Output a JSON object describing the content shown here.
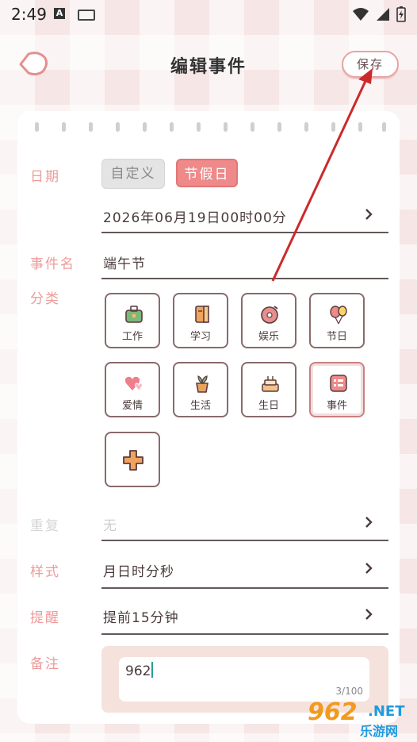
{
  "status": {
    "time": "2:49",
    "a_icon": "A"
  },
  "header": {
    "title": "编辑事件",
    "save_label": "保存"
  },
  "form": {
    "date_label": "日期",
    "date_tabs": [
      "自定义",
      "节假日"
    ],
    "date_value": "2026年06月19日00时00分",
    "name_label": "事件名",
    "name_value": "端午节",
    "category_label": "分类",
    "categories": [
      "工作",
      "学习",
      "娱乐",
      "节日",
      "爱情",
      "生活",
      "生日",
      "事件"
    ],
    "repeat_label": "重复",
    "repeat_value": "无",
    "style_label": "样式",
    "style_value": "月日时分秒",
    "remind_label": "提醒",
    "remind_value": "提前15分钟",
    "notes_label": "备注",
    "notes_value": "962",
    "notes_count": "3/100"
  },
  "watermark": {
    "logo": "962",
    "net": ".NET",
    "sub": "乐游网"
  },
  "colors": {
    "accent": "#ef8a8a",
    "label_pink": "#ef9a9a",
    "arrow": "#cc2a2a"
  }
}
